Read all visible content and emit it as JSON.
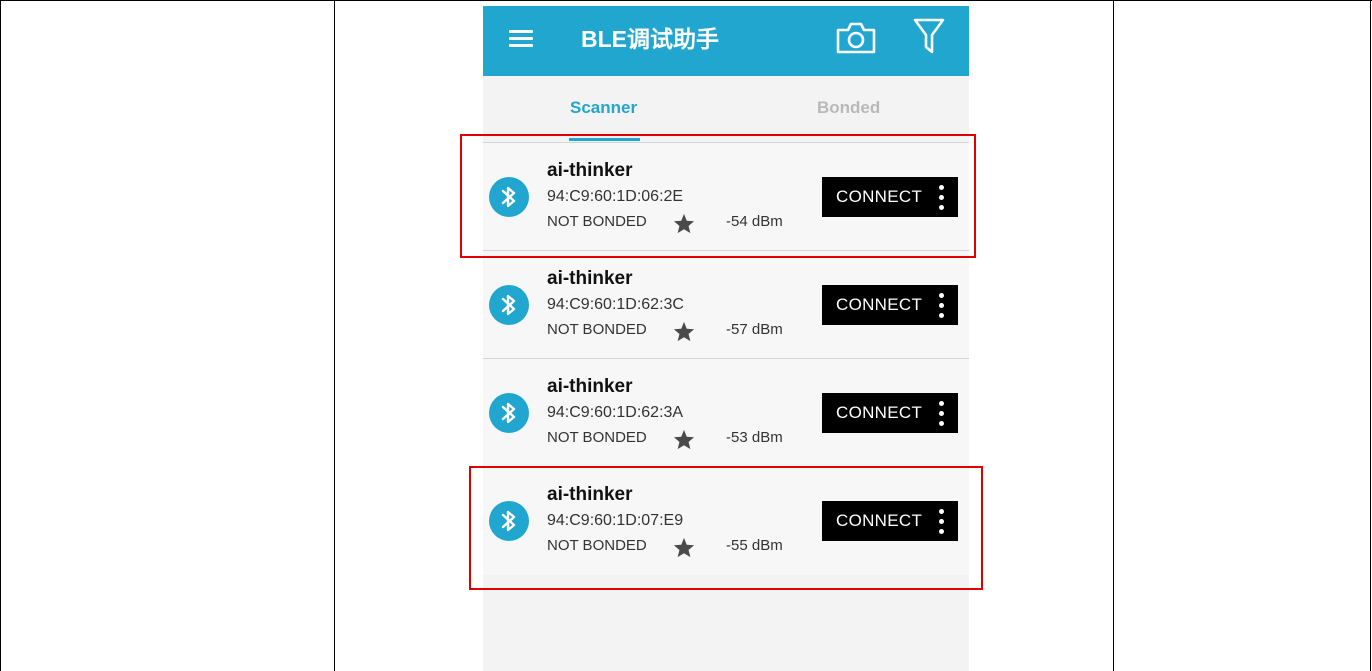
{
  "app": {
    "title": "BLE调试助手",
    "menu_icon": "menu-icon",
    "camera_icon": "camera-icon",
    "filter_icon": "filter-icon",
    "accent_color": "#21a6d0"
  },
  "tabs": [
    {
      "label": "Scanner",
      "active": true
    },
    {
      "label": "Bonded",
      "active": false
    }
  ],
  "devices": [
    {
      "name": "ai-thinker",
      "address": "94:C9:60:1D:06:2E",
      "bond_state": "NOT BONDED",
      "rssi": "-54 dBm",
      "action": "CONNECT",
      "highlighted": true
    },
    {
      "name": "ai-thinker",
      "address": "94:C9:60:1D:62:3C",
      "bond_state": "NOT BONDED",
      "rssi": "-57 dBm",
      "action": "CONNECT",
      "highlighted": false
    },
    {
      "name": "ai-thinker",
      "address": "94:C9:60:1D:62:3A",
      "bond_state": "NOT BONDED",
      "rssi": "-53 dBm",
      "action": "CONNECT",
      "highlighted": false
    },
    {
      "name": "ai-thinker",
      "address": "94:C9:60:1D:07:E9",
      "bond_state": "NOT BONDED",
      "rssi": "-55 dBm",
      "action": "CONNECT",
      "highlighted": true
    }
  ],
  "highlight_color": "#e00000"
}
